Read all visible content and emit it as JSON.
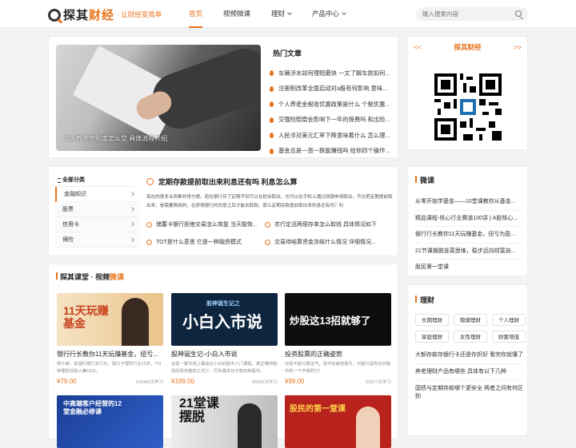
{
  "header": {
    "logo_text_a": "探其",
    "logo_text_b": "财经",
    "slogan": "· 让财经变简单",
    "nav": [
      {
        "label": "首页",
        "active": true,
        "dropdown": false
      },
      {
        "label": "视频微课",
        "active": false,
        "dropdown": false
      },
      {
        "label": "理财",
        "active": false,
        "dropdown": true
      },
      {
        "label": "产品中心",
        "active": false,
        "dropdown": true
      }
    ],
    "search_placeholder": "输入搜索内容"
  },
  "hero": {
    "caption": "个人养老金制度怎么交 具体流程介绍"
  },
  "hot": {
    "title": "热门文章",
    "items": [
      "车辆涉水如何理赔最快 一文了解车损如何...",
      "注册制改革全面启动对a股有何影响 意味...",
      "个人养老金税收优惠政策是什么 个税优惠...",
      "交强险赔偿会影响下一年的保费吗 和出险...",
      "人民币对美元汇率下降意味着什么 怎么理...",
      "基金总是一涨一跌能赚钱吗 给你四个操作..."
    ]
  },
  "categories": {
    "title": "全部分类",
    "items": [
      "金融知识",
      "股票",
      "信用卡",
      "保险"
    ]
  },
  "feature": {
    "title": "定期存款提前取出来利息还有吗 利息怎么算",
    "desc": "现在的很多业务都非常方便，若在银行存了定期不仅可以在柜台取出，也可以在手机上通过网银申请取出。不过把定期提前取出来，是需要费用的，在获得银行的同意之后才能去取款。那么定期存款提前取出来利息还有吗？利",
    "links": [
      "储蓄卡银行拒绝交易怎么恢复 当天能恢...",
      "农行定活两便存单怎么取钱 具体情况如下",
      "TOT是什么意思 它是一种融资模式",
      "交易待结算资金冻结什么情况 详细情况..."
    ]
  },
  "courses": {
    "title_a": "探其课堂 · 视频",
    "title_b": "微课",
    "items": [
      {
        "name": "银行行长教你11天玩赚基金，扭亏...",
        "desc": "郭子斋：前湖行银行支行长，独力于理财行业15年，7分钟理财创始人兼CEO。",
        "price": "¥79.00",
        "learners": "103466次学习",
        "thumb_text": "11天玩赚基金"
      },
      {
        "name": "股神诞生记-小白入市说",
        "desc": "这是一套市场上最适合小白的股市入门课程，真正懂你股民的投资者的之交少，打好基本功才能玩转股市。",
        "price": "¥199.00",
        "learners": "90591次学习",
        "thumb_text": "小白入市说",
        "thumb_sub": "股神诞生记之"
      },
      {
        "name": "投资股票的正确姿势",
        "desc": "炒股不能只靠运气，选不好就容易亏，可能只是你在炒股中的一个开端而已！",
        "price": "¥99.00",
        "learners": "59377次学习",
        "thumb_text": "炒股这13招就够了"
      },
      {
        "name": "",
        "desc": "",
        "price": "",
        "learners": "",
        "thumb_text": "中高端客户经营的12堂金融必修课"
      },
      {
        "name": "",
        "desc": "",
        "price": "",
        "learners": "",
        "thumb_text": "21堂课 摆脱"
      },
      {
        "name": "",
        "desc": "",
        "price": "",
        "learners": "",
        "thumb_text": "股民的第一堂课"
      }
    ]
  },
  "qr": {
    "title": "探其财经",
    "prev": "<<",
    "next": ">>"
  },
  "weike": {
    "title": "微课",
    "items": [
      "从零开始学基金——10堂课教你从基金...",
      "精品课程-核心行业赛道100讲 | A股核心...",
      "银行行长教你11天玩赚基金，扭亏为盈...",
      "21节课摆脱韭菜思维，稳步迈向财富自...",
      "股民第一堂课"
    ]
  },
  "licai": {
    "title": "理财",
    "tags": [
      "长期理财",
      "稳健理财",
      "个人理财",
      "家庭理财",
      "女性理财",
      "财富增值"
    ],
    "items": [
      "大额存款存银行卡还是存折好 看完你就懂了",
      "养老理财产品有哪些 具体有以下几种",
      "国债与定期存款哪个更安全 两者之间有何区别"
    ]
  },
  "colors": {
    "accent": "#e8731c",
    "background": "#f3f3f3"
  }
}
